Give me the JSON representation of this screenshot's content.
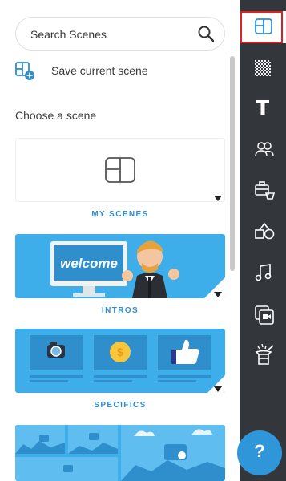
{
  "search": {
    "placeholder": "Search Scenes"
  },
  "save_scene": {
    "label": "Save current scene"
  },
  "section_title": "Choose a scene",
  "categories": [
    {
      "label": "MY SCENES"
    },
    {
      "label": "INTROS",
      "banner_text": "welcome"
    },
    {
      "label": "SPECIFICS"
    }
  ],
  "toolbar": {
    "items": [
      {
        "name": "scenes",
        "icon": "layout-icon",
        "active": true
      },
      {
        "name": "backgrounds",
        "icon": "checkerboard-icon",
        "active": false
      },
      {
        "name": "text",
        "icon": "text-icon",
        "active": false
      },
      {
        "name": "characters",
        "icon": "people-icon",
        "active": false
      },
      {
        "name": "props",
        "icon": "props-icon",
        "active": false
      },
      {
        "name": "shapes",
        "icon": "shapes-icon",
        "active": false
      },
      {
        "name": "music",
        "icon": "music-icon",
        "active": false
      },
      {
        "name": "media",
        "icon": "media-icon",
        "active": false
      },
      {
        "name": "effects",
        "icon": "magic-hat-icon",
        "active": false
      }
    ],
    "help_label": "?"
  },
  "colors": {
    "accent": "#3daee9",
    "toolbar_bg": "#33373c",
    "caption": "#2e8fcf",
    "active_outline": "#e02020",
    "help": "#2f97d9"
  }
}
